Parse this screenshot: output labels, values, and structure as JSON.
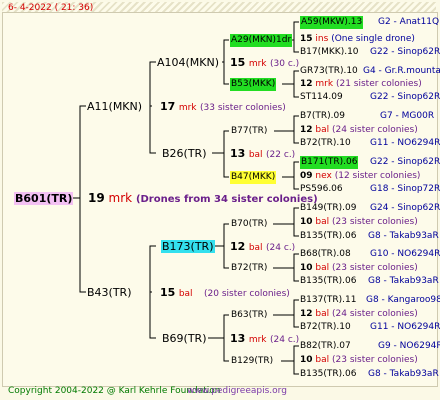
{
  "date": "6-  4-2022 ( 21: 36)",
  "footer": {
    "copyright": "Copyright 2004-2022 @ Karl Kehrle Foundation",
    "site": "www.pedigreeapis.org"
  },
  "root": {
    "name": "B601(TR)",
    "num": "19",
    "type": "mrk",
    "note": "(Drones from 34 sister colonies)"
  },
  "gen1": [
    {
      "name": "A11(MKN)",
      "num": "17",
      "type": "mrk",
      "note": "(33 sister colonies)"
    },
    {
      "name": "B43(TR)",
      "num": "15",
      "type": "bal",
      "note": "(20 sister colonies)"
    }
  ],
  "gen2": [
    {
      "name": "A104(MKN)",
      "num": "15",
      "type": "mrk",
      "note": "(30 c.)"
    },
    {
      "name": "B26(TR)",
      "num": "13",
      "type": "bal",
      "note": "(22 c.)"
    },
    {
      "name": "B173(TR)",
      "num": "12",
      "type": "bal",
      "note": "(24 c.)"
    },
    {
      "name": "B69(TR)",
      "num": "13",
      "type": "mrk",
      "note": "(24 c.)"
    }
  ],
  "gen3": [
    {
      "name": "A29(MKN)1dr",
      "num": "15",
      "type": "ins",
      "note": "(One single drone)"
    },
    {
      "name": "B53(MKK)",
      "num": "12",
      "type": "mrk",
      "note": "(21 sister colonies)"
    },
    {
      "name": "B77(TR)",
      "num": "12",
      "type": "bal",
      "note": "(24 sister colonies)"
    },
    {
      "name": "B47(MKK)",
      "num": "09",
      "type": "nex",
      "note": "(12 sister colonies)"
    },
    {
      "name": "B70(TR)",
      "num": "10",
      "type": "bal",
      "note": "(23 sister colonies)"
    },
    {
      "name": "B72(TR)",
      "num": "10",
      "type": "bal",
      "note": "(23 sister colonies)"
    },
    {
      "name": "B63(TR)",
      "num": "12",
      "type": "bal",
      "note": "(24 sister colonies)"
    },
    {
      "name": "B129(TR)",
      "num": "10",
      "type": "bal",
      "note": "(23 sister colonies)"
    }
  ],
  "gen4": [
    {
      "name": "A59(MKW).13",
      "code": "G2 - Anat11Q"
    },
    {
      "name": "B17(MKK).10",
      "code": "G22 - Sinop62R"
    },
    {
      "name": "GR73(TR).10",
      "code": "G4 - Gr.R.mounta"
    },
    {
      "name": "ST114.09",
      "code": "G22 - Sinop62R"
    },
    {
      "name": "B7(TR).09",
      "code": "G7 - MG00R"
    },
    {
      "name": "B72(TR).10",
      "code": "G11 - NO6294R"
    },
    {
      "name": "B171(TR).06",
      "code": "G22 - Sinop62R"
    },
    {
      "name": "PS596.06",
      "code": "G18 - Sinop72R"
    },
    {
      "name": "B149(TR).09",
      "code": "G24 - Sinop62R"
    },
    {
      "name": "B135(TR).06",
      "code": "G8 - Takab93aR"
    },
    {
      "name": "B68(TR).08",
      "code": "G10 - NO6294R"
    },
    {
      "name": "B135(TR).06",
      "code": "G8 - Takab93aR"
    },
    {
      "name": "B137(TR).11",
      "code": "G8 - Kangaroo98R"
    },
    {
      "name": "B72(TR).10",
      "code": "G11 - NO6294R"
    },
    {
      "name": "B82(TR).07",
      "code": "G9 - NO6294R"
    },
    {
      "name": "B135(TR).06",
      "code": "G8 - Takab93aR"
    }
  ],
  "colors": {
    "green": "#22dd22",
    "yellow": "#ffff33",
    "cyan": "#33e0ee",
    "pink": "#f3c0f3",
    "mating_red": "#d40000",
    "notes_blue": "#00009b"
  }
}
